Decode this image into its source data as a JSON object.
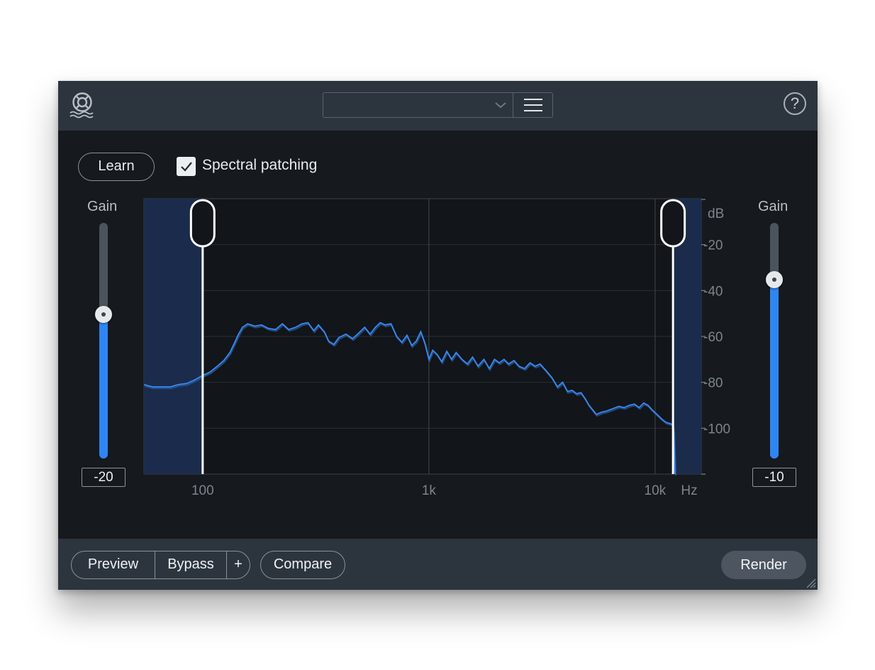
{
  "topbar": {
    "logo_icon": "lifebuoy-icon",
    "preset_value": "",
    "preset_dropdown_icon": "chevron-down-icon",
    "preset_menu_icon": "hamburger-menu-icon",
    "help_label": "?"
  },
  "controls": {
    "learn_label": "Learn",
    "spectral_patching_label": "Spectral patching",
    "spectral_patching_checked": true
  },
  "left_fader": {
    "label": "Gain",
    "value": "-20",
    "level_fraction": 0.61
  },
  "right_fader": {
    "label": "Gain",
    "value": "-10",
    "level_fraction": 0.76
  },
  "chart_data": {
    "type": "line",
    "xscale": "log",
    "xlim": [
      55,
      16000
    ],
    "ylim": [
      0,
      120
    ],
    "x_ticks": [
      {
        "value": 100,
        "label": "100"
      },
      {
        "value": 1000,
        "label": "1k"
      },
      {
        "value": 10000,
        "label": "10k"
      }
    ],
    "x_unit": "Hz",
    "y_unit": "dB",
    "y_ticks": [
      {
        "value": 20,
        "label": "-20"
      },
      {
        "value": 40,
        "label": "-40"
      },
      {
        "value": 60,
        "label": "-60"
      },
      {
        "value": 80,
        "label": "-80"
      },
      {
        "value": 100,
        "label": "-100"
      }
    ],
    "low_cut_hz": 100,
    "high_cut_hz": 12000,
    "series": [
      {
        "color": "#3a89ef",
        "points": [
          [
            55,
            81
          ],
          [
            60,
            82
          ],
          [
            65,
            82
          ],
          [
            72,
            82
          ],
          [
            78,
            81
          ],
          [
            85,
            80.5
          ],
          [
            92,
            79
          ],
          [
            100,
            77
          ],
          [
            108,
            75.5
          ],
          [
            116,
            73
          ],
          [
            124,
            70.5
          ],
          [
            132,
            67
          ],
          [
            138,
            63
          ],
          [
            144,
            59
          ],
          [
            150,
            56
          ],
          [
            158,
            54.5
          ],
          [
            170,
            55.5
          ],
          [
            182,
            55
          ],
          [
            195,
            56.5
          ],
          [
            210,
            57
          ],
          [
            225,
            54.5
          ],
          [
            240,
            57
          ],
          [
            258,
            56
          ],
          [
            275,
            54.5
          ],
          [
            292,
            54
          ],
          [
            310,
            57.5
          ],
          [
            325,
            55
          ],
          [
            345,
            58
          ],
          [
            360,
            62
          ],
          [
            380,
            63.5
          ],
          [
            400,
            60.5
          ],
          [
            430,
            59
          ],
          [
            460,
            61
          ],
          [
            490,
            58.5
          ],
          [
            520,
            56
          ],
          [
            550,
            59
          ],
          [
            580,
            56
          ],
          [
            610,
            54
          ],
          [
            640,
            55
          ],
          [
            680,
            54.5
          ],
          [
            720,
            60
          ],
          [
            760,
            62.5
          ],
          [
            800,
            59.5
          ],
          [
            840,
            64
          ],
          [
            880,
            62
          ],
          [
            920,
            58
          ],
          [
            960,
            63
          ],
          [
            1000,
            70
          ],
          [
            1040,
            66
          ],
          [
            1090,
            68
          ],
          [
            1140,
            71
          ],
          [
            1200,
            66.5
          ],
          [
            1260,
            70
          ],
          [
            1320,
            67
          ],
          [
            1400,
            70
          ],
          [
            1480,
            72
          ],
          [
            1560,
            69
          ],
          [
            1650,
            73
          ],
          [
            1750,
            70
          ],
          [
            1850,
            74
          ],
          [
            1950,
            70
          ],
          [
            2050,
            71.5
          ],
          [
            2150,
            70
          ],
          [
            2250,
            72
          ],
          [
            2380,
            70.5
          ],
          [
            2500,
            73
          ],
          [
            2650,
            74
          ],
          [
            2800,
            71.5
          ],
          [
            2950,
            73
          ],
          [
            3100,
            72
          ],
          [
            3300,
            75
          ],
          [
            3500,
            78
          ],
          [
            3700,
            82
          ],
          [
            3900,
            80
          ],
          [
            4100,
            84
          ],
          [
            4300,
            83.5
          ],
          [
            4500,
            85
          ],
          [
            4700,
            84.5
          ],
          [
            4900,
            87
          ],
          [
            5100,
            90
          ],
          [
            5300,
            92
          ],
          [
            5500,
            94
          ],
          [
            5800,
            93
          ],
          [
            6100,
            92.5
          ],
          [
            6500,
            91.5
          ],
          [
            6900,
            90.5
          ],
          [
            7300,
            91
          ],
          [
            7700,
            90
          ],
          [
            8100,
            89.5
          ],
          [
            8500,
            91
          ],
          [
            8900,
            89
          ],
          [
            9300,
            90
          ],
          [
            9700,
            92
          ],
          [
            10200,
            94
          ],
          [
            10700,
            96
          ],
          [
            11200,
            97.5
          ],
          [
            11700,
            98
          ],
          [
            12000,
            98.5
          ],
          [
            12100,
            102
          ],
          [
            12250,
            120
          ]
        ]
      }
    ]
  },
  "footer": {
    "preview_label": "Preview",
    "bypass_label": "Bypass",
    "plus_label": "+",
    "compare_label": "Compare",
    "render_label": "Render",
    "resize_icon": "resize-grip-icon"
  }
}
